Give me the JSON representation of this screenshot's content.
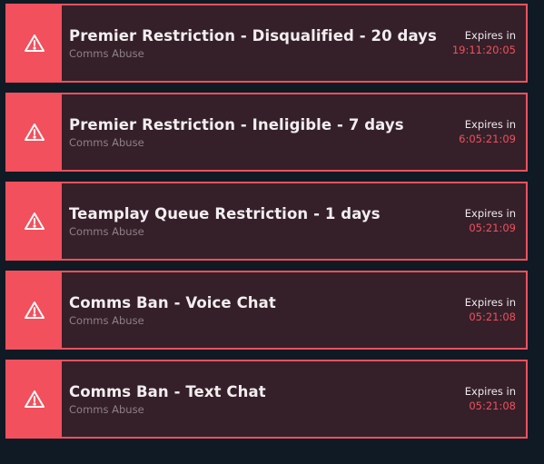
{
  "colors": {
    "background": "#0f1a24",
    "card_background": "#352029",
    "accent": "#f0505d",
    "title_text": "#f2eef0",
    "sub_text": "#8e8088"
  },
  "restrictions": [
    {
      "icon": "warning-icon",
      "title": "Premier Restriction - Disqualified - 20 days",
      "reason": "Comms Abuse",
      "expires_label": "Expires in",
      "expires_time": "19:11:20:05"
    },
    {
      "icon": "warning-icon",
      "title": "Premier Restriction - Ineligible - 7 days",
      "reason": "Comms Abuse",
      "expires_label": "Expires in",
      "expires_time": "6:05:21:09"
    },
    {
      "icon": "warning-icon",
      "title": "Teamplay Queue Restriction - 1 days",
      "reason": "Comms Abuse",
      "expires_label": "Expires in",
      "expires_time": "05:21:09"
    },
    {
      "icon": "warning-icon",
      "title": "Comms Ban - Voice Chat",
      "reason": "Comms Abuse",
      "expires_label": "Expires in",
      "expires_time": "05:21:08"
    },
    {
      "icon": "warning-icon",
      "title": "Comms Ban - Text Chat",
      "reason": "Comms Abuse",
      "expires_label": "Expires in",
      "expires_time": "05:21:08"
    }
  ]
}
